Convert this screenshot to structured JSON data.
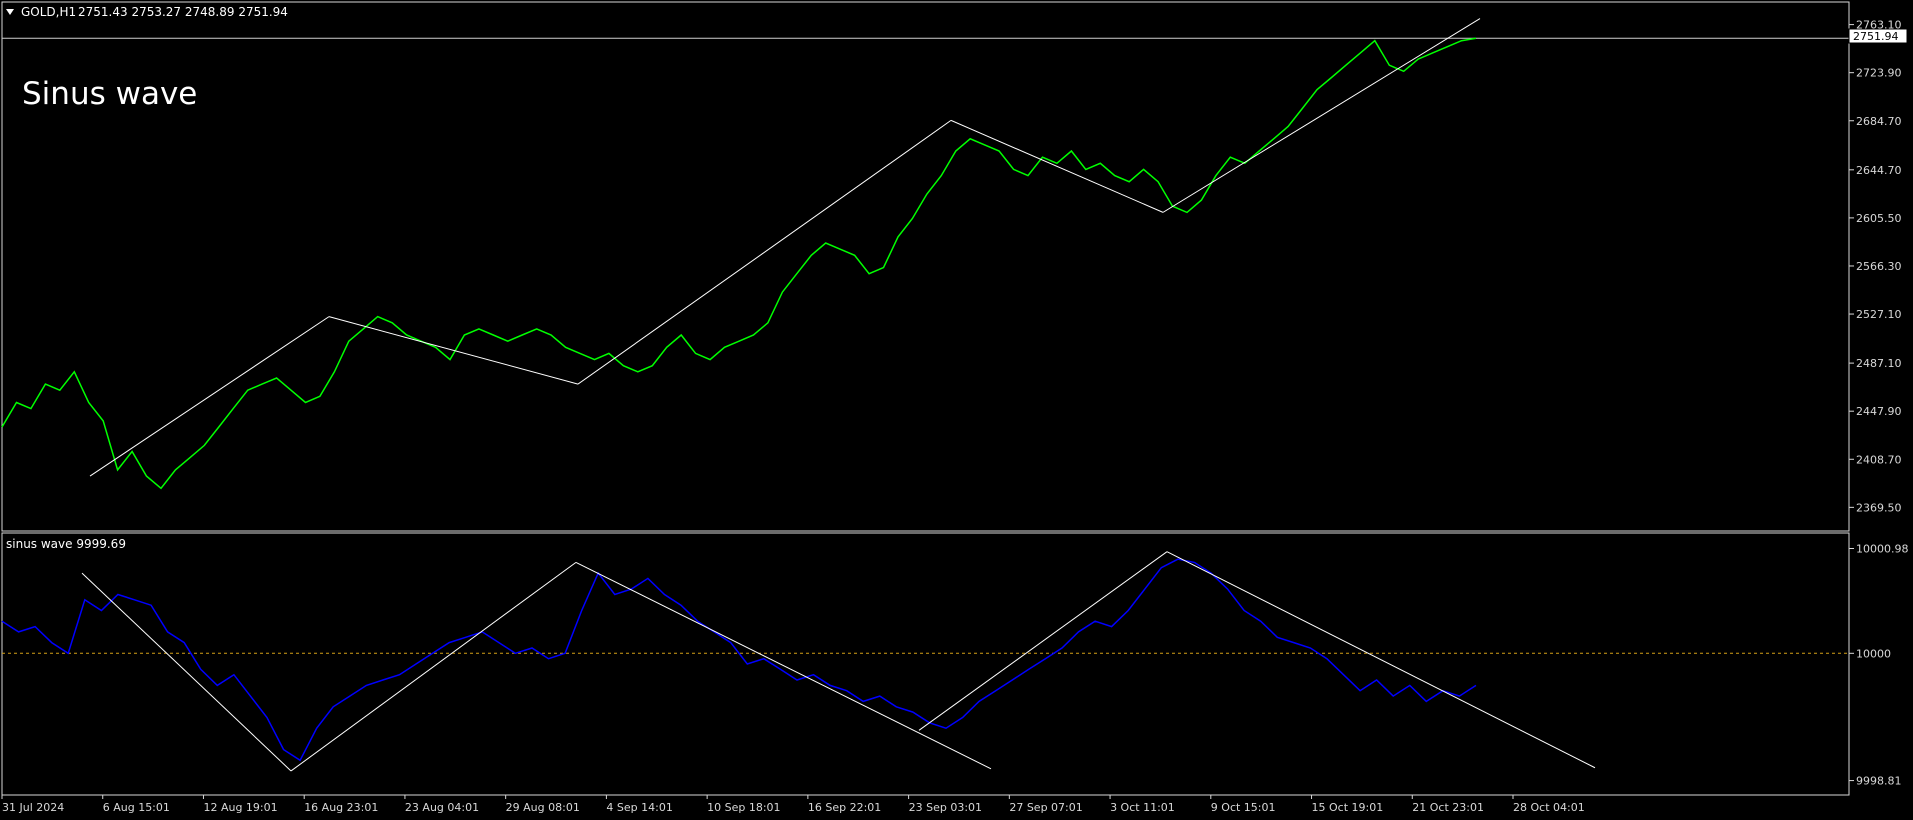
{
  "window": {
    "symbol_label": "GOLD,H1",
    "ohlc": "2751.43 2753.27 2748.89 2751.94",
    "annotation": "Sinus wave"
  },
  "price_pane": {
    "current_price": "2751.94",
    "y_ticks": [
      "2763.10",
      "2723.90",
      "2684.70",
      "2644.70",
      "2605.50",
      "2566.30",
      "2527.10",
      "2487.10",
      "2447.90",
      "2408.70",
      "2369.50"
    ],
    "series_color": "#00ff00"
  },
  "indicator_pane": {
    "title": "sinus wave 9999.69",
    "y_ticks": [
      "10000.98",
      "10000",
      "9998.81"
    ],
    "series_color": "#0000ff",
    "level_color": "#d4a017"
  },
  "time_axis": {
    "labels": [
      "31 Jul 2024",
      "6 Aug 15:01",
      "12 Aug 19:01",
      "16 Aug 23:01",
      "23 Aug 04:01",
      "29 Aug 08:01",
      "4 Sep 14:01",
      "10 Sep 18:01",
      "16 Sep 22:01",
      "23 Sep 03:01",
      "27 Sep 07:01",
      "3 Oct 11:01",
      "9 Oct 15:01",
      "15 Oct 19:01",
      "21 Oct 23:01",
      "28 Oct 04:01"
    ]
  },
  "chart_data": [
    {
      "type": "line",
      "title": "GOLD,H1",
      "series": [
        {
          "name": "GOLD,H1",
          "values": [
            2435,
            2455,
            2450,
            2470,
            2465,
            2480,
            2455,
            2440,
            2400,
            2415,
            2395,
            2385,
            2400,
            2410,
            2420,
            2435,
            2450,
            2465,
            2470,
            2475,
            2465,
            2455,
            2460,
            2480,
            2505,
            2515,
            2525,
            2520,
            2510,
            2505,
            2500,
            2490,
            2510,
            2515,
            2510,
            2505,
            2510,
            2515,
            2510,
            2500,
            2495,
            2490,
            2495,
            2485,
            2480,
            2485,
            2500,
            2510,
            2495,
            2490,
            2500,
            2505,
            2510,
            2520,
            2545,
            2560,
            2575,
            2585,
            2580,
            2575,
            2560,
            2565,
            2590,
            2605,
            2625,
            2640,
            2660,
            2670,
            2665,
            2660,
            2645,
            2640,
            2655,
            2650,
            2660,
            2645,
            2650,
            2640,
            2635,
            2645,
            2635,
            2615,
            2610,
            2620,
            2640,
            2655,
            2650,
            2660,
            2670,
            2680,
            2695,
            2710,
            2720,
            2730,
            2740,
            2750,
            2730,
            2725,
            2735,
            2740,
            2745,
            2750,
            2752
          ]
        }
      ],
      "y_ticks": [
        2763.1,
        2723.9,
        2684.7,
        2644.7,
        2605.5,
        2566.3,
        2527.1,
        2487.1,
        2447.9,
        2408.7,
        2369.5
      ],
      "ylim": [
        2360,
        2775
      ],
      "grid": false
    },
    {
      "type": "line",
      "title": "sinus wave 9999.69",
      "series": [
        {
          "name": "sinus wave",
          "values": [
            10000.3,
            10000.2,
            10000.25,
            10000.1,
            10000.0,
            10000.5,
            10000.4,
            10000.55,
            10000.5,
            10000.45,
            10000.2,
            10000.1,
            9999.85,
            9999.7,
            9999.8,
            9999.6,
            9999.4,
            9999.1,
            9999.0,
            9999.3,
            9999.5,
            9999.6,
            9999.7,
            9999.75,
            9999.8,
            9999.9,
            10000.0,
            10000.1,
            10000.15,
            10000.2,
            10000.1,
            10000.0,
            10000.05,
            9999.95,
            10000.0,
            10000.4,
            10000.75,
            10000.55,
            10000.6,
            10000.7,
            10000.55,
            10000.45,
            10000.3,
            10000.2,
            10000.1,
            9999.9,
            9999.95,
            9999.85,
            9999.75,
            9999.8,
            9999.7,
            9999.65,
            9999.55,
            9999.6,
            9999.5,
            9999.45,
            9999.35,
            9999.3,
            9999.4,
            9999.55,
            9999.65,
            9999.75,
            9999.85,
            9999.95,
            10000.05,
            10000.2,
            10000.3,
            10000.25,
            10000.4,
            10000.6,
            10000.8,
            10000.88,
            10000.85,
            10000.75,
            10000.6,
            10000.4,
            10000.3,
            10000.15,
            10000.1,
            10000.05,
            9999.95,
            9999.8,
            9999.65,
            9999.75,
            9999.6,
            9999.7,
            9999.55,
            9999.65,
            9999.6,
            9999.7
          ]
        }
      ],
      "y_ticks": [
        10000.98,
        10000,
        9998.81
      ],
      "ylim": [
        9998.75,
        10001.05
      ],
      "level": 10000,
      "grid": false
    }
  ]
}
